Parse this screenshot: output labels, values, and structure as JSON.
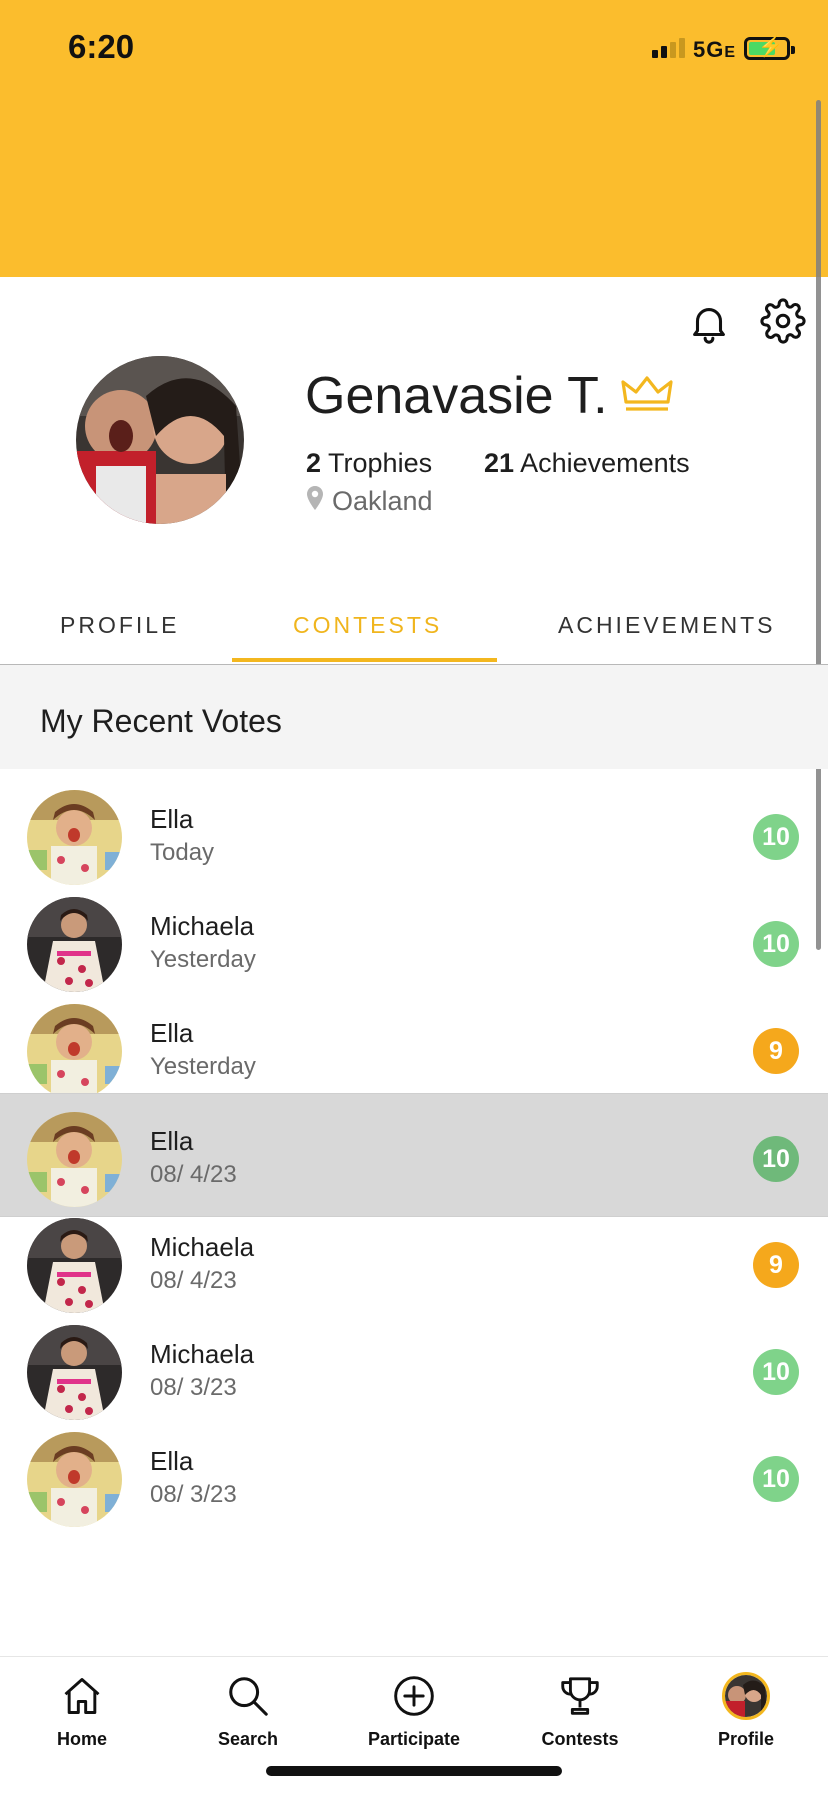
{
  "status_bar": {
    "time": "6:20",
    "network": "5G",
    "network_suffix": "E"
  },
  "profile": {
    "name": "Genavasie T.",
    "trophies_count": "2",
    "trophies_label": "Trophies",
    "achievements_count": "21",
    "achievements_label": "Achievements",
    "location": "Oakland"
  },
  "tabs": [
    {
      "label": "PROFILE"
    },
    {
      "label": "CONTESTS"
    },
    {
      "label": "ACHIEVEMENTS"
    }
  ],
  "section_title": "My Recent Votes",
  "votes": [
    {
      "name": "Ella",
      "date": "Today",
      "score": "10",
      "score_color": "#7fd38a",
      "photo": "ella"
    },
    {
      "name": "Michaela",
      "date": "Yesterday",
      "score": "10",
      "score_color": "#7fd38a",
      "photo": "michaela"
    },
    {
      "name": "Ella",
      "date": "Yesterday",
      "score": "9",
      "score_color": "#f5a81c",
      "photo": "ella"
    },
    {
      "name": "Ella",
      "date": "08/ 4/23",
      "score": "10",
      "score_color": "#6fb97a",
      "photo": "ella",
      "highlighted": true
    },
    {
      "name": "Michaela",
      "date": "08/ 4/23",
      "score": "9",
      "score_color": "#f5a81c",
      "photo": "michaela"
    },
    {
      "name": "Michaela",
      "date": "08/ 3/23",
      "score": "10",
      "score_color": "#7fd38a",
      "photo": "michaela"
    },
    {
      "name": "Ella",
      "date": "08/ 3/23",
      "score": "10",
      "score_color": "#7fd38a",
      "photo": "ella"
    }
  ],
  "bottom_nav": [
    {
      "label": "Home",
      "icon": "home-icon"
    },
    {
      "label": "Search",
      "icon": "search-icon"
    },
    {
      "label": "Participate",
      "icon": "plus-circle-icon"
    },
    {
      "label": "Contests",
      "icon": "trophy-icon"
    },
    {
      "label": "Profile",
      "icon": "avatar"
    }
  ],
  "colors": {
    "brand_yellow": "#fbbd2d",
    "accent": "#f3b71f",
    "score_green": "#7fd38a",
    "score_orange": "#f5a81c"
  }
}
